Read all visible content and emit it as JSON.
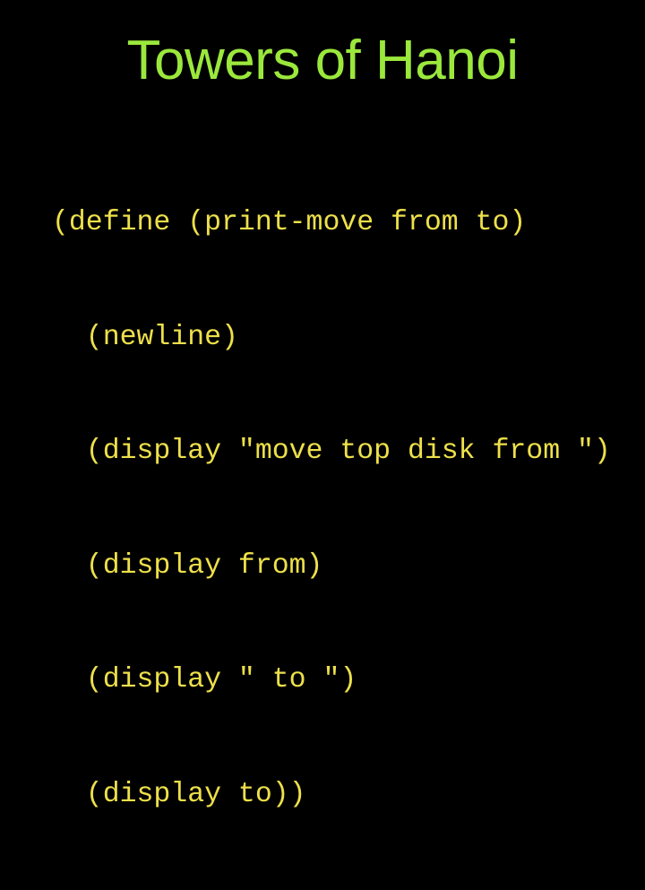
{
  "slide": {
    "background_color": "#000000",
    "title": "Towers of Hanoi",
    "title_color": "#9be83c",
    "code_color": "#ede04a",
    "code_lines": [
      "(define (print-move from to)",
      "  (newline)",
      "  (display \"move top disk from \")",
      "  (display from)",
      "  (display \" to \")",
      "  (display to))"
    ]
  }
}
